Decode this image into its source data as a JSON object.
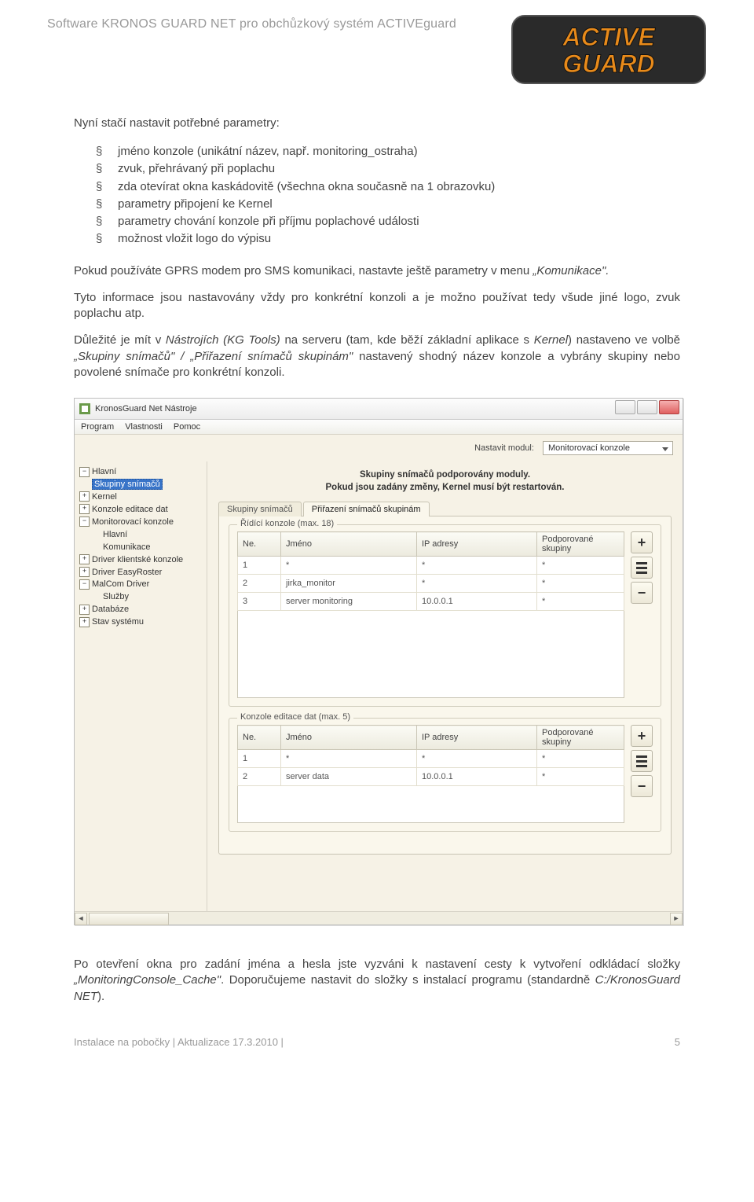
{
  "header": {
    "title": "Software KRONOS GUARD NET pro obchůzkový systém ACTIVEguard",
    "logo_top": "ACTIVE",
    "logo_bottom": "GUARD"
  },
  "content": {
    "intro": "Nyní stačí nastavit potřebné parametry:",
    "bullets": [
      "jméno konzole (unikátní název, např. monitoring_ostraha)",
      "zvuk, přehrávaný při poplachu",
      "zda otevírat okna kaskádovitě (všechna okna současně na 1 obrazovku)",
      "parametry připojení ke Kernel",
      "parametry chování konzole při příjmu poplachové události",
      "možnost vložit logo do výpisu"
    ],
    "p1a": "Pokud používáte GPRS modem pro SMS komunikaci, nastavte ještě parametry v menu ",
    "p1b": "„Komunikace\".",
    "p2": "Tyto informace jsou nastavovány vždy pro konkrétní konzoli a je možno používat tedy všude jiné logo, zvuk poplachu atp.",
    "p3a": "Důležité je mít v ",
    "p3b": "Nástrojích (KG Tools)",
    "p3c": " na serveru (tam, kde běží základní aplikace s ",
    "p3d": "Kernel",
    "p3e": ") nastaveno ve volbě ",
    "p3f": "„Skupiny snímačů\" / „Přiřazení snímačů skupinám\"",
    "p3g": " nastavený shodný název konzole a vybrány skupiny nebo povolené snímače pro konkrétní konzoli.",
    "p4a": "Po otevření okna pro zadání jména a hesla jste vyzváni k nastavení cesty k vytvoření odkládací složky ",
    "p4b": "„MonitoringConsole_Cache\"",
    "p4c": ". Doporučujeme nastavit do složky s instalací programu (standardně ",
    "p4d": "C:/KronosGuard NET",
    "p4e": ")."
  },
  "screenshot": {
    "window_title": "KronosGuard Net Nástroje",
    "menu": [
      "Program",
      "Vlastnosti",
      "Pomoc"
    ],
    "module_label": "Nastavit modul:",
    "module_value": "Monitorovací konzole",
    "tree": {
      "n0": "Hlavní",
      "n0_sel": "Skupiny snímačů",
      "n1": "Kernel",
      "n2": "Konzole editace dat",
      "n3": "Monitorovací konzole",
      "n3a": "Hlavní",
      "n3b": "Komunikace",
      "n4": "Driver klientské konzole",
      "n5": "Driver EasyRoster",
      "n6": "MalCom Driver",
      "n6a": "Služby",
      "n7": "Databáze",
      "n8": "Stav systému"
    },
    "heading_l1": "Skupiny snímačů podporovány moduly.",
    "heading_l2": "Pokud jsou zadány změny, Kernel musí být restartován.",
    "tabs": {
      "t1": "Skupiny snímačů",
      "t2": "Přiřazení snímačů skupinám"
    },
    "group1": {
      "legend": "Řídící konzole (max. 18)",
      "cols": [
        "Ne.",
        "Jméno",
        "IP adresy",
        "Podporované skupiny"
      ],
      "rows": [
        [
          "1",
          "*",
          "*",
          "*"
        ],
        [
          "2",
          "jirka_monitor",
          "*",
          "*"
        ],
        [
          "3",
          "server monitoring",
          "10.0.0.1",
          "*"
        ]
      ]
    },
    "group2": {
      "legend": "Konzole editace dat (max. 5)",
      "cols": [
        "Ne.",
        "Jméno",
        "IP adresy",
        "Podporované skupiny"
      ],
      "rows": [
        [
          "1",
          "*",
          "*",
          "*"
        ],
        [
          "2",
          "server data",
          "10.0.0.1",
          "*"
        ]
      ]
    }
  },
  "footer": {
    "left": "Instalace na pobočky | Aktualizace 17.3.2010 |",
    "right": "5"
  }
}
